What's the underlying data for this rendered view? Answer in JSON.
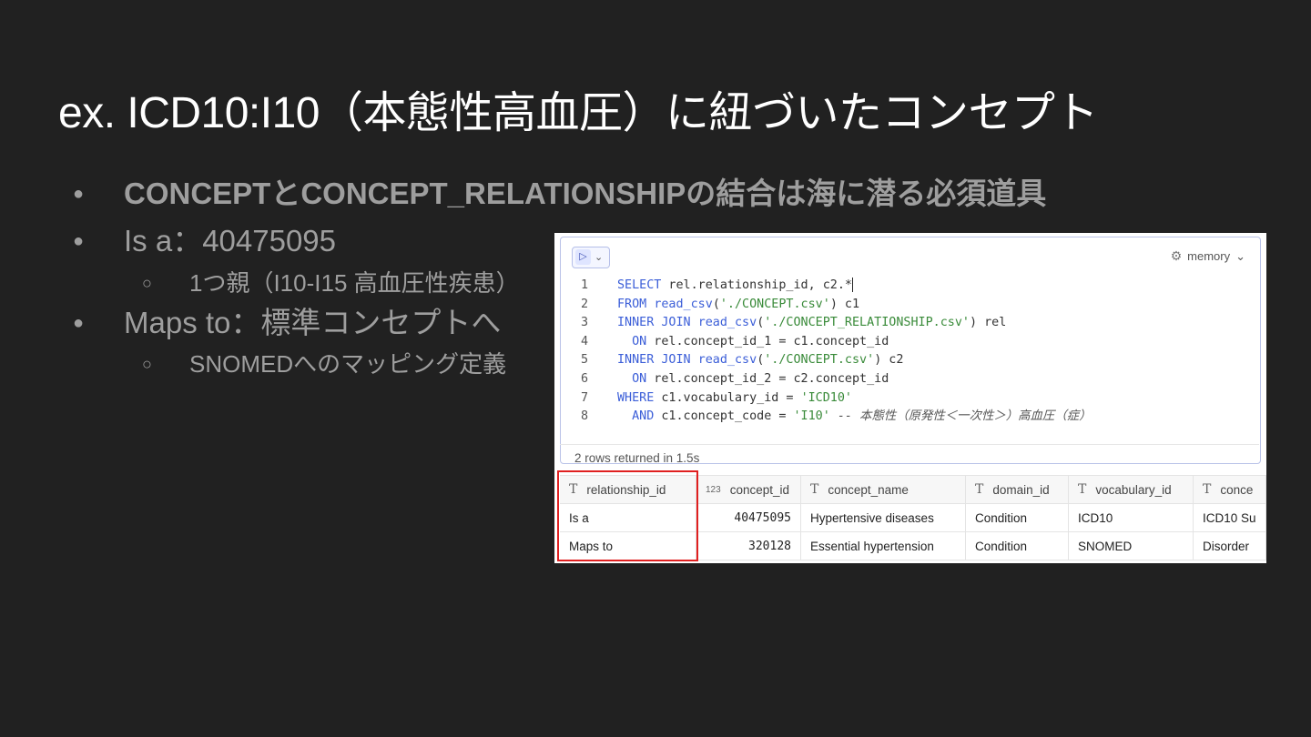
{
  "title": "ex. ICD10:I10（本態性高血圧）に紐づいたコンセプト",
  "bullets": [
    {
      "text": "CONCEPTとCONCEPT_RELATIONSHIPの結合は海に潜る必須道具",
      "level": 1,
      "bold": true
    },
    {
      "text": "Is a：40475095",
      "level": 1
    },
    {
      "text": "1つ親（I10-I15 高血圧性疾患）",
      "level": 2
    },
    {
      "text": "Maps to：標準コンセプトへ",
      "level": 1
    },
    {
      "text": "SNOMEDへのマッピング定義",
      "level": 2
    }
  ],
  "bullet_markers": {
    "level1": "●",
    "level2": "○"
  },
  "editor": {
    "run_icon": "play-icon",
    "run_symbol": "▷",
    "dropdown_symbol": "⌄",
    "memory_label": "memory",
    "memory_icon": "gear-icon",
    "memory_chevron": "⌄",
    "code_lines": [
      {
        "num": "1",
        "text": "SELECT rel.relationship_id, c2.*"
      },
      {
        "num": "2",
        "text": "FROM read_csv('./CONCEPT.csv') c1"
      },
      {
        "num": "3",
        "text": "INNER JOIN read_csv('./CONCEPT_RELATIONSHIP.csv') rel"
      },
      {
        "num": "4",
        "text": "  ON rel.concept_id_1 = c1.concept_id"
      },
      {
        "num": "5",
        "text": "INNER JOIN read_csv('./CONCEPT.csv') c2"
      },
      {
        "num": "6",
        "text": "  ON rel.concept_id_2 = c2.concept_id"
      },
      {
        "num": "7",
        "text": "WHERE c1.vocabulary_id = 'ICD10'"
      },
      {
        "num": "8",
        "text": "  AND c1.concept_code = 'I10' -- 本態性（原発性＜一次性＞）高血圧（症）"
      }
    ]
  },
  "results": {
    "status": "2 rows returned in 1.5s",
    "columns": [
      {
        "type_icon": "T",
        "name": "relationship_id"
      },
      {
        "type_icon": "123",
        "name": "concept_id"
      },
      {
        "type_icon": "T",
        "name": "concept_name"
      },
      {
        "type_icon": "T",
        "name": "domain_id"
      },
      {
        "type_icon": "T",
        "name": "vocabulary_id"
      },
      {
        "type_icon": "T",
        "name": "conce"
      }
    ],
    "rows": [
      [
        "Is a",
        "40475095",
        "Hypertensive diseases",
        "Condition",
        "ICD10",
        "ICD10 Su"
      ],
      [
        "Maps to",
        "320128",
        "Essential hypertension",
        "Condition",
        "SNOMED",
        "Disorder"
      ]
    ]
  },
  "colors": {
    "background": "#212121",
    "title": "#ffffff",
    "bullet_text": "#9e9e9e",
    "highlight": "#e02020",
    "keyword": "#3b5ed8",
    "string": "#3a8b3a"
  }
}
